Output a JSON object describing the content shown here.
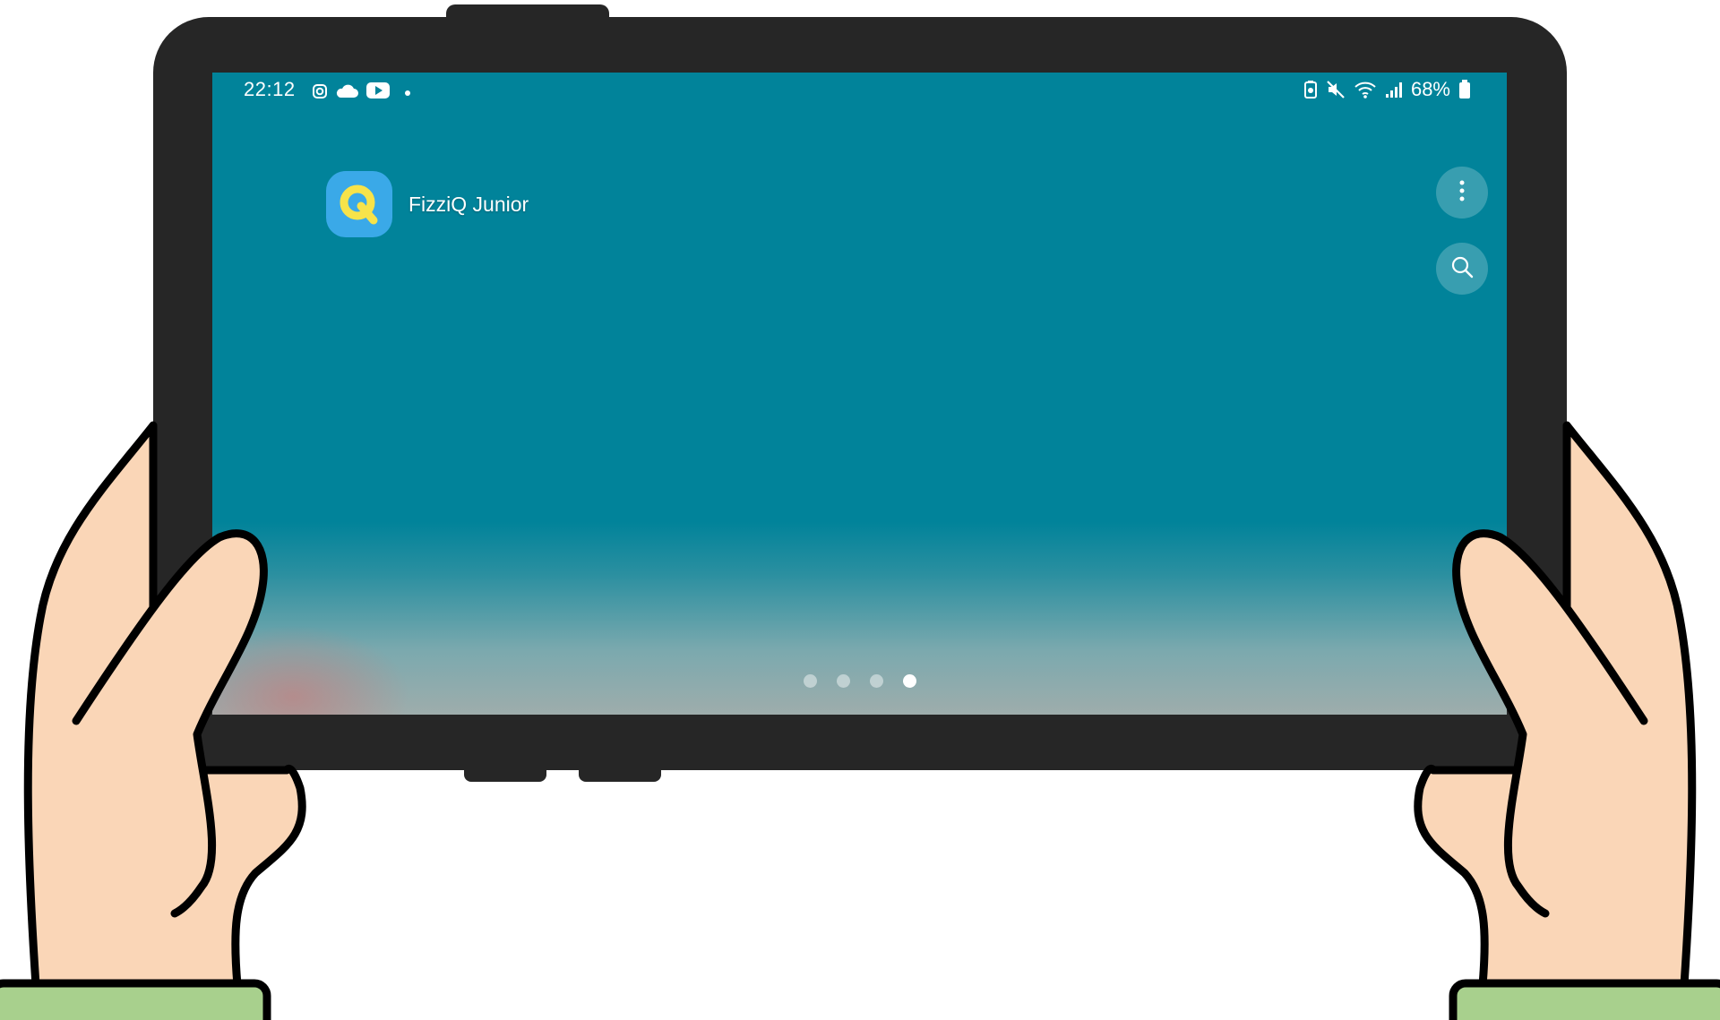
{
  "status_bar": {
    "time": "22:12",
    "left_icons": [
      "instagram-icon",
      "cloud-icon",
      "youtube-icon",
      "notification-dot-icon"
    ],
    "right_icons": [
      "battery-saver-icon",
      "mute-icon",
      "wifi-icon",
      "signal-icon"
    ],
    "battery_percent": "68%"
  },
  "home": {
    "app": {
      "label": "FizziQ Junior",
      "icon": "fizziq-junior-icon"
    },
    "buttons": {
      "more": "more-options-icon",
      "search": "search-icon"
    }
  },
  "pager": {
    "count": 4,
    "active_index": 3
  },
  "colors": {
    "wallpaper": "#01839a",
    "tablet_frame": "#262626",
    "skin": "#fad6b7",
    "sleeve": "#a8d08d",
    "app_icon_bg": "#3aa9e8",
    "app_icon_fg": "#f7e34a"
  }
}
